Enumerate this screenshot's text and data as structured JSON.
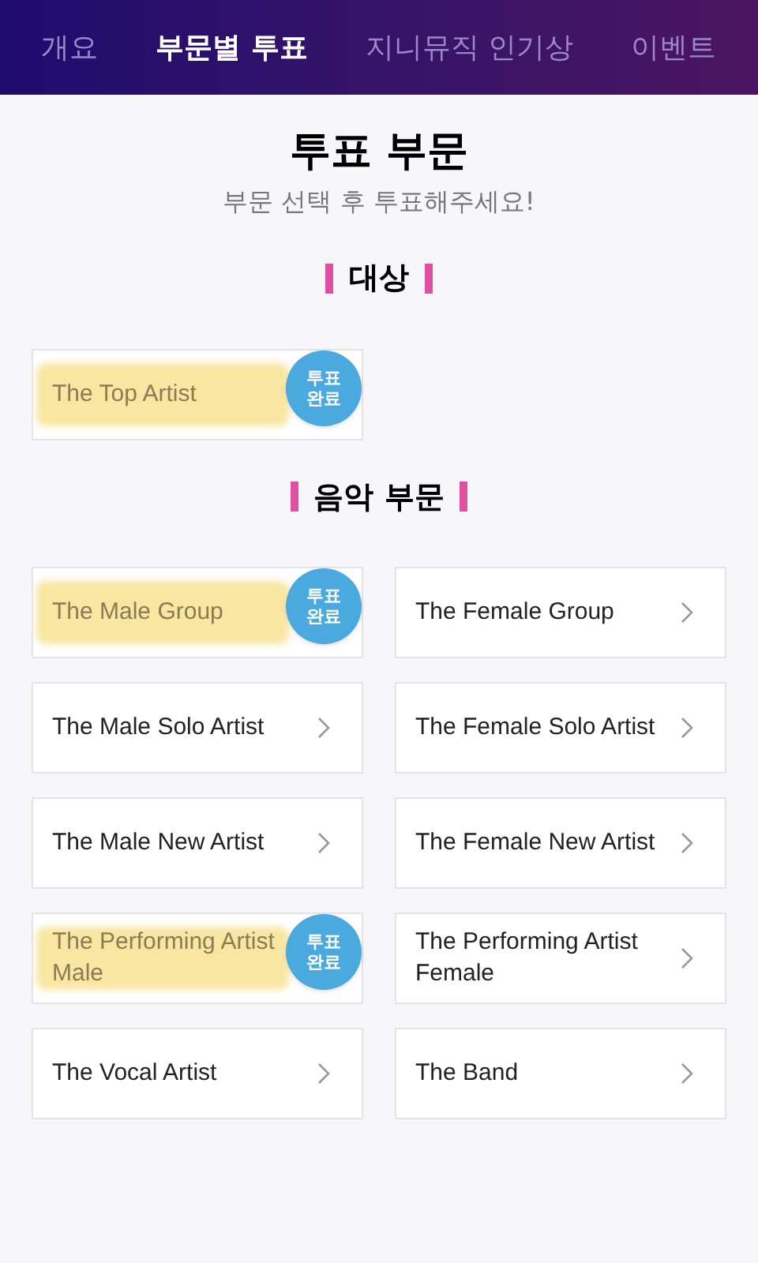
{
  "tabs": [
    {
      "label": "개요",
      "selected": false
    },
    {
      "label": "부문별 투표",
      "selected": true
    },
    {
      "label": "지니뮤직 인기상",
      "selected": false
    },
    {
      "label": "이벤트",
      "selected": false
    }
  ],
  "header": {
    "title": "투표 부문",
    "subtitle": "부문 선택 후 투표해주세요!"
  },
  "sections": [
    {
      "title": "대상",
      "categories": [
        {
          "label": "The Top Artist",
          "voted": true,
          "badge": "투표 완료",
          "highlighted": true
        }
      ]
    },
    {
      "title": "음악 부문",
      "categories": [
        {
          "label": "The Male Group",
          "voted": true,
          "badge": "투표 완료",
          "highlighted": true
        },
        {
          "label": "The Female Group",
          "voted": false,
          "highlighted": false
        },
        {
          "label": "The Male Solo Artist",
          "voted": false,
          "highlighted": false
        },
        {
          "label": "The Female Solo Artist",
          "voted": false,
          "highlighted": false
        },
        {
          "label": "The Male New Artist",
          "voted": false,
          "highlighted": false
        },
        {
          "label": "The Female New Artist",
          "voted": false,
          "highlighted": false
        },
        {
          "label": "The Performing Artist Male",
          "voted": true,
          "badge": "투표 완료",
          "highlighted": true
        },
        {
          "label": "The Performing Artist Female",
          "voted": false,
          "highlighted": false
        },
        {
          "label": "The Vocal Artist",
          "voted": false,
          "highlighted": false
        },
        {
          "label": "The Band",
          "voted": false,
          "highlighted": false
        }
      ]
    }
  ]
}
